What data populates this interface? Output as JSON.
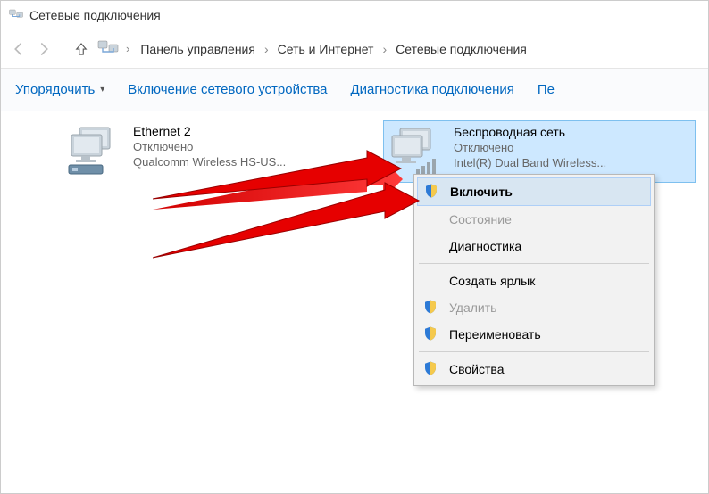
{
  "window": {
    "title": "Сетевые подключения"
  },
  "breadcrumb": {
    "items": [
      "Панель управления",
      "Сеть и Интернет",
      "Сетевые подключения"
    ]
  },
  "toolbar": {
    "organize": "Упорядочить",
    "enable_device": "Включение сетевого устройства",
    "diagnose": "Диагностика подключения",
    "rename_trunc": "Пе"
  },
  "adapters": {
    "ethernet": {
      "name": "Ethernet 2",
      "status": "Отключено",
      "device": "Qualcomm Wireless HS-US..."
    },
    "wireless": {
      "name": "Беспроводная сеть",
      "status": "Отключено",
      "device": "Intel(R) Dual Band Wireless..."
    }
  },
  "context_menu": {
    "enable": "Включить",
    "status": "Состояние",
    "diagnose": "Диагностика",
    "create_shortcut": "Создать ярлык",
    "delete": "Удалить",
    "rename": "Переименовать",
    "properties": "Свойства"
  }
}
